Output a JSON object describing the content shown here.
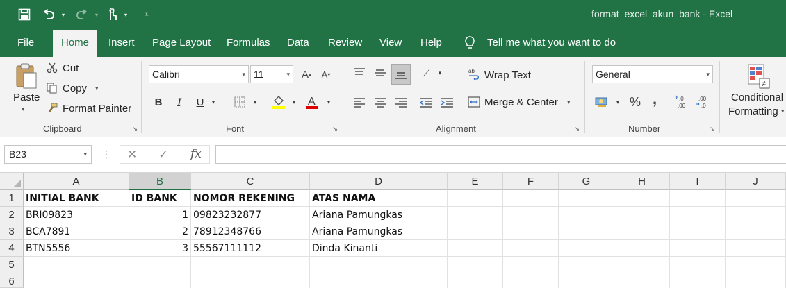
{
  "titlebar": {
    "title": "format_excel_akun_bank  -  Excel",
    "colors": {
      "brand": "#217346"
    }
  },
  "qat": [
    "save-icon",
    "undo-icon",
    "redo-icon",
    "touch-mode-icon",
    "customize-qat-icon"
  ],
  "tabs": [
    {
      "label": "File"
    },
    {
      "label": "Home",
      "active": true
    },
    {
      "label": "Insert"
    },
    {
      "label": "Page Layout"
    },
    {
      "label": "Formulas"
    },
    {
      "label": "Data"
    },
    {
      "label": "Review"
    },
    {
      "label": "View"
    },
    {
      "label": "Help"
    }
  ],
  "tell_me": "Tell me what you want to do",
  "ribbon": {
    "clipboard": {
      "label": "Clipboard",
      "paste": "Paste",
      "cut": "Cut",
      "copy": "Copy",
      "format_painter": "Format Painter"
    },
    "font": {
      "label": "Font",
      "font_name": "Calibri",
      "font_size": "11",
      "bold": "B",
      "italic": "I",
      "underline": "U"
    },
    "alignment": {
      "label": "Alignment",
      "wrap_text": "Wrap Text",
      "merge_center": "Merge & Center"
    },
    "number": {
      "label": "Number",
      "format": "General",
      "percent": "%",
      "comma": ","
    },
    "styles": {
      "conditional_line1": "Conditional",
      "conditional_line2": "Formatting"
    }
  },
  "formula_bar": {
    "name_box": "B23",
    "fx": "fx",
    "value": ""
  },
  "sheet": {
    "columns": [
      "A",
      "B",
      "C",
      "D",
      "E",
      "F",
      "G",
      "H",
      "I",
      "J"
    ],
    "selected_column": "B",
    "rows": [
      {
        "num": "1",
        "cells": [
          "INITIAL BANK",
          "ID BANK",
          "NOMOR REKENING",
          "ATAS NAMA"
        ]
      },
      {
        "num": "2",
        "cells": [
          "BRI09823",
          "1",
          "09823232877",
          "Ariana Pamungkas"
        ]
      },
      {
        "num": "3",
        "cells": [
          "BCA7891",
          "2",
          "78912348766",
          "Ariana Pamungkas"
        ]
      },
      {
        "num": "4",
        "cells": [
          "BTN5556",
          "3",
          "55567111112",
          "Dinda Kinanti"
        ]
      },
      {
        "num": "5",
        "cells": [
          "",
          "",
          "",
          ""
        ]
      },
      {
        "num": "6",
        "cells": [
          "",
          "",
          "",
          ""
        ]
      }
    ]
  }
}
